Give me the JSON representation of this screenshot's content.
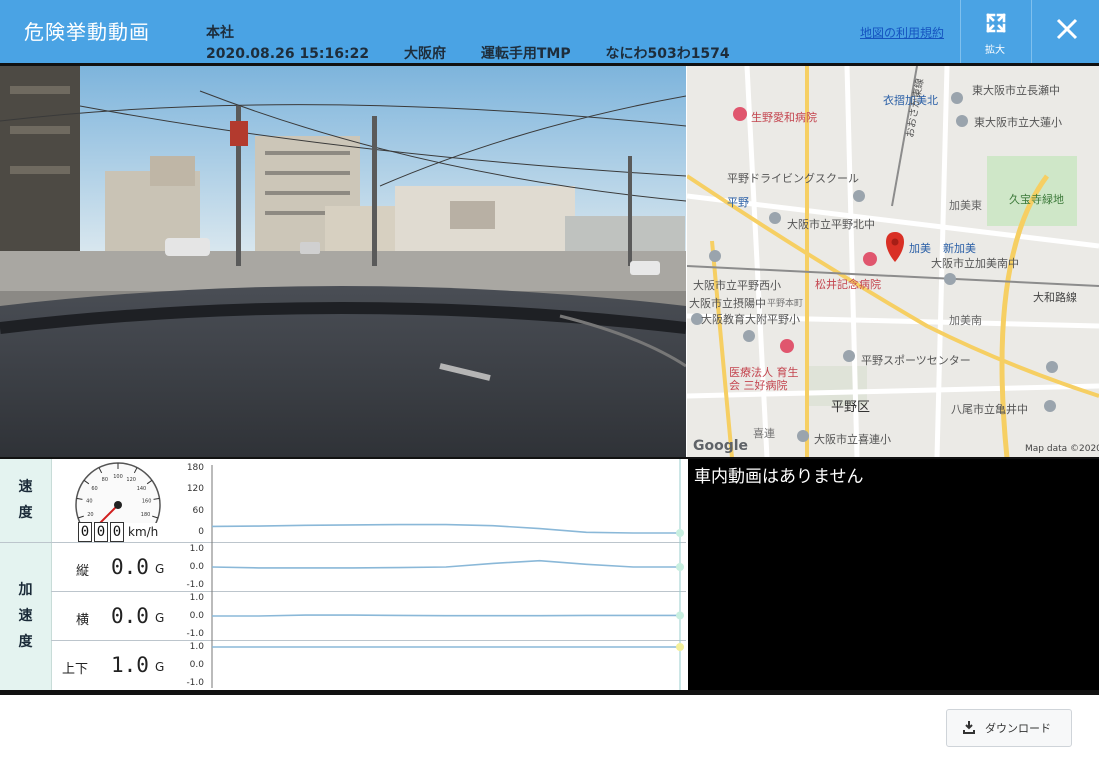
{
  "header": {
    "title": "危険挙動動画",
    "office": "本社",
    "datetime": "2020.08.26 15:16:22",
    "prefecture": "大阪府",
    "driver": "運転手用TMP",
    "plate": "なにわ503わ1574",
    "map_terms_link": "地図の利用規約",
    "expand_label": "拡大",
    "accent_color": "#4aa3e4"
  },
  "map": {
    "labels": [
      {
        "text": "衣摺加美北"
      },
      {
        "text": "東大阪市立長瀬中"
      },
      {
        "text": "生野愛和病院"
      },
      {
        "text": "東大阪市立大蓮小"
      },
      {
        "text": "平野ドライビングスクール"
      },
      {
        "text": "平野"
      },
      {
        "text": "加美東"
      },
      {
        "text": "久宝寺緑地"
      },
      {
        "text": "大阪市立平野北中"
      },
      {
        "text": "新加美"
      },
      {
        "text": "大阪市立加美南中"
      },
      {
        "text": "大阪市立平野西小"
      },
      {
        "text": "松井記念病院"
      },
      {
        "text": "大和路線"
      },
      {
        "text": "大阪市立摂陽中"
      },
      {
        "text": "平野本町"
      },
      {
        "text": "大阪教育大附平野小"
      },
      {
        "text": "加美南"
      },
      {
        "text": "平野スポーツセンター"
      },
      {
        "text": "医療法人 育生"
      },
      {
        "text": "会 三好病院"
      },
      {
        "text": "平野区"
      },
      {
        "text": "八尾市立亀井中"
      },
      {
        "text": "喜連"
      },
      {
        "text": "大阪市立喜連小"
      },
      {
        "text": "おおさか東線"
      },
      {
        "text": "加美"
      }
    ],
    "google_logo": "Google",
    "attribution": "Map data ©2020"
  },
  "gauges": {
    "speed_label_chars": [
      "速",
      "度"
    ],
    "accel_label_chars": [
      "加",
      "速",
      "度"
    ],
    "speed_digits": [
      "0",
      "0",
      "0"
    ],
    "speed_unit": "km/h",
    "speed_dial_ticks": [
      "0",
      "20",
      "40",
      "60",
      "80",
      "100",
      "120",
      "140",
      "160",
      "180",
      "200"
    ],
    "speed_needle_value": 0,
    "speed_axis": [
      "180",
      "120",
      "60",
      "0"
    ],
    "accel_axis": [
      "1.0",
      "0.0",
      "-1.0"
    ],
    "longitudinal": {
      "label": "縦",
      "value": "0.0",
      "unit": "G"
    },
    "lateral": {
      "label": "横",
      "value": "0.0",
      "unit": "G"
    },
    "vertical": {
      "label": "上下",
      "value": "1.0",
      "unit": "G"
    },
    "line_color": "#8ab8d8"
  },
  "chart_data": [
    {
      "type": "line",
      "name": "speed",
      "ylim": [
        0,
        180
      ],
      "x": [
        0,
        10,
        20,
        30,
        40,
        50,
        60,
        70,
        80,
        90,
        100
      ],
      "values": [
        18,
        19,
        21,
        22,
        23,
        23,
        20,
        12,
        2,
        0,
        0
      ]
    },
    {
      "type": "line",
      "name": "longitudinal",
      "ylim": [
        -1,
        1
      ],
      "x": [
        0,
        10,
        20,
        30,
        40,
        50,
        60,
        70,
        80,
        90,
        100
      ],
      "values": [
        0.0,
        -0.05,
        -0.05,
        -0.05,
        -0.03,
        0.0,
        0.2,
        0.35,
        0.15,
        0.0,
        0.0
      ]
    },
    {
      "type": "line",
      "name": "lateral",
      "ylim": [
        -1,
        1
      ],
      "x": [
        0,
        10,
        20,
        30,
        40,
        50,
        60,
        70,
        80,
        90,
        100
      ],
      "values": [
        0.0,
        0.0,
        0.05,
        0.05,
        0.03,
        0.02,
        0.02,
        0.02,
        0.03,
        0.03,
        0.03
      ]
    },
    {
      "type": "line",
      "name": "vertical",
      "ylim": [
        -1,
        1
      ],
      "x": [
        0,
        10,
        20,
        30,
        40,
        50,
        60,
        70,
        80,
        90,
        100
      ],
      "values": [
        1.0,
        1.0,
        1.0,
        1.0,
        1.0,
        1.0,
        1.0,
        1.0,
        1.0,
        1.0,
        1.0
      ]
    }
  ],
  "interior": {
    "message": "車内動画はありません"
  },
  "download": {
    "label": "ダウンロード"
  }
}
